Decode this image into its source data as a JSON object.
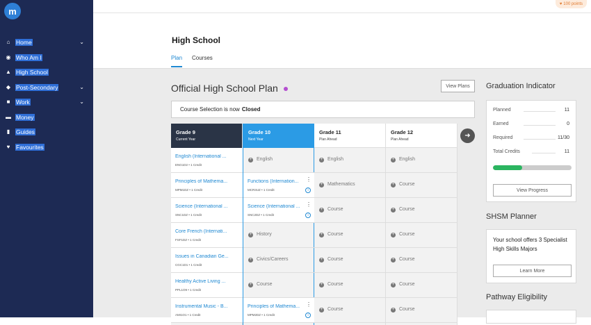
{
  "app": {
    "logo": "m"
  },
  "sidebar": {
    "items": [
      {
        "label": "Home",
        "icon": "home-icon",
        "glyph": "⌂",
        "chevron": true
      },
      {
        "label": "Who Am I",
        "icon": "compass-icon",
        "glyph": "◉",
        "chevron": false
      },
      {
        "label": "High School",
        "icon": "school-icon",
        "glyph": "▲",
        "chevron": false
      },
      {
        "label": "Post-Secondary",
        "icon": "graduation-icon",
        "glyph": "◆",
        "chevron": true
      },
      {
        "label": "Work",
        "icon": "briefcase-icon",
        "glyph": "■",
        "chevron": true
      },
      {
        "label": "Money",
        "icon": "money-icon",
        "glyph": "▬",
        "chevron": false
      },
      {
        "label": "Guides",
        "icon": "book-icon",
        "glyph": "▮",
        "chevron": false
      },
      {
        "label": "Favourites",
        "icon": "heart-icon",
        "glyph": "♥",
        "chevron": false
      }
    ]
  },
  "topbar": {
    "points": "100 points",
    "points_icon": "heart-icon"
  },
  "header": {
    "title": "High School",
    "tabs": [
      "Plan",
      "Courses"
    ],
    "active_tab": "Plan"
  },
  "main": {
    "plan_title": "Official High School Plan",
    "view_plans": "View Plans",
    "notice_prefix": "Course Selection is now",
    "notice_status": "Closed",
    "grades": [
      {
        "title": "Grade 9",
        "sub": "Current Year",
        "cells": [
          {
            "type": "course",
            "name": "English (International ...",
            "code": "ENG1D2 • 1 Credit"
          },
          {
            "type": "course",
            "name": "Principles of Mathema...",
            "code": "MPM1DZ • 1 Credit"
          },
          {
            "type": "course",
            "name": "Science (International ...",
            "code": "SNC1DZ • 1 Credit"
          },
          {
            "type": "course",
            "name": "Core French (Internati...",
            "code": "FSF1DZ • 1 Credit"
          },
          {
            "type": "course",
            "name": "Issues in Canadian Ge...",
            "code": "CGC1D1 • 1 Credit"
          },
          {
            "type": "course",
            "name": "Healthy Active Living ...",
            "code": "PPL1O9 • 1 Credit"
          },
          {
            "type": "course",
            "name": "Instrumental Music - B...",
            "code": "AMI1O1 • 1 Credit"
          }
        ]
      },
      {
        "title": "Grade 10",
        "sub": "Next Year",
        "cells": [
          {
            "type": "slot",
            "name": "English"
          },
          {
            "type": "course",
            "name": "Functions (Internation...",
            "code": "MCR3UZ • 1 Credit",
            "menu": true
          },
          {
            "type": "course",
            "name": "Science (International ...",
            "code": "SNC2DZ • 1 Credit",
            "menu": true
          },
          {
            "type": "slot",
            "name": "History"
          },
          {
            "type": "slot",
            "name": "Civics/Careers"
          },
          {
            "type": "slot",
            "name": "Course"
          },
          {
            "type": "course",
            "name": "Principles of Mathema...",
            "code": "MPM2DZ • 1 Credit",
            "menu": true
          }
        ]
      },
      {
        "title": "Grade 11",
        "sub": "Plan Ahead",
        "cells": [
          {
            "type": "slot",
            "name": "English"
          },
          {
            "type": "slot",
            "name": "Mathematics"
          },
          {
            "type": "slot",
            "name": "Course"
          },
          {
            "type": "slot",
            "name": "Course"
          },
          {
            "type": "slot",
            "name": "Course"
          },
          {
            "type": "slot",
            "name": "Course"
          },
          {
            "type": "slot",
            "name": "Course"
          }
        ]
      },
      {
        "title": "Grade 12",
        "sub": "Plan Ahead",
        "cells": [
          {
            "type": "slot",
            "name": "English"
          },
          {
            "type": "slot",
            "name": "Course"
          },
          {
            "type": "slot",
            "name": "Course"
          },
          {
            "type": "slot",
            "name": "Course"
          },
          {
            "type": "slot",
            "name": "Course"
          },
          {
            "type": "slot",
            "name": "Course"
          },
          {
            "type": "slot",
            "name": "Course"
          }
        ]
      }
    ]
  },
  "graduation": {
    "title": "Graduation Indicator",
    "rows": [
      {
        "label": "Planned",
        "value": "11"
      },
      {
        "label": "Earned",
        "value": "0"
      },
      {
        "label": "Required",
        "value": "11/30"
      },
      {
        "label": "Total Credits",
        "value": "11"
      }
    ],
    "progress_fraction": 0.37,
    "button": "View Progress"
  },
  "shsm": {
    "title": "SHSM Planner",
    "text": "Your school offers 3 Specialist High Skills Majors",
    "button": "Learn More"
  },
  "pathway": {
    "title": "Pathway Eligibility"
  },
  "colors": {
    "sidebar": "#1d2a54",
    "accent": "#1e88d2",
    "grade_current": "#2a3446",
    "grade_next": "#2b9be5",
    "progress": "#2bb560"
  }
}
